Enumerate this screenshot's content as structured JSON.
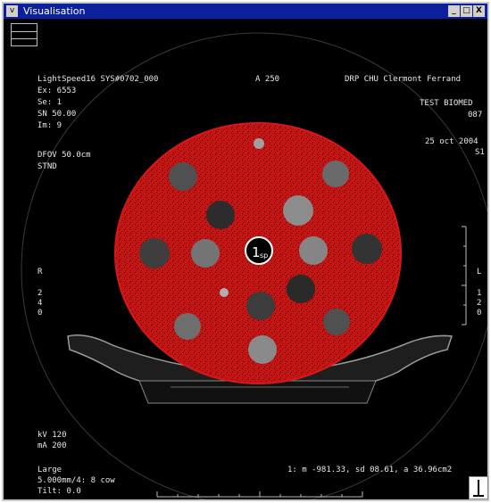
{
  "window": {
    "title": "Visualisation",
    "minimize": "_",
    "maximize": "□",
    "close": "X",
    "sysmenu": "v"
  },
  "overlay": {
    "line1_left": "LightSpeed16 SYS#0702_000",
    "line1_mid": "A 250",
    "line1_right": "DRP CHU Clermont Ferrand",
    "ex": "Ex: 6553",
    "se": "Se: 1",
    "sn": "SN 50.00",
    "im": "Im: 9",
    "test": "TEST BIOMED",
    "num": "087",
    "date": "25 oct 2004",
    "slice": "S1",
    "dfov": "DFOV 50.0cm",
    "stnd": "STND",
    "r_label": "R",
    "vert_digits": [
      "2",
      "4",
      "0"
    ],
    "right_side_l": "L",
    "right_side_digits": [
      "1",
      "2",
      "0"
    ],
    "kv": "kV 120",
    "ma": "mA 200",
    "large": "Large",
    "thickness": "5.000mm/4: 8 cow",
    "tilt": "Tilt: 0.0",
    "stats": "1: m -981.33, sd 08.61, a 36.96cm2"
  },
  "roi_label": "1",
  "roi_sub": "sp",
  "colors": {
    "phantom": "#c41414",
    "background": "#000000",
    "title_bar": "#0c1f9c"
  }
}
